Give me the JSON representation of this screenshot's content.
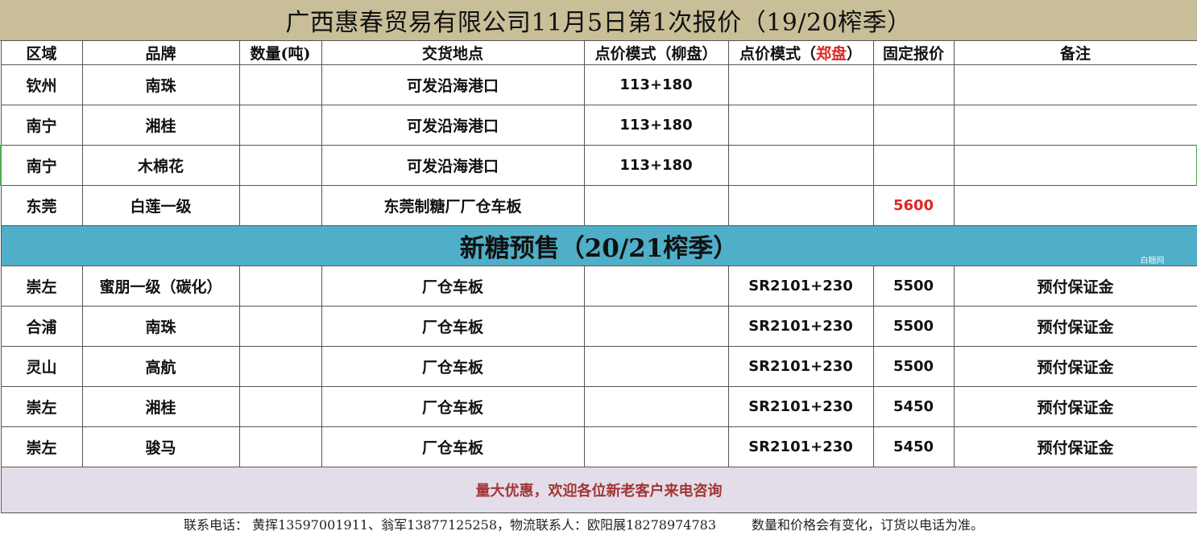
{
  "title": "广西惠春贸易有限公司11月5日第1次报价（19/20榨季）",
  "headers": {
    "region": "区域",
    "brand": "品牌",
    "quantity": "数量(吨)",
    "delivery": "交货地点",
    "pricing_liu_prefix": "点价模式（柳盘）",
    "pricing_zheng_prefix": "点价模式（",
    "pricing_zheng_red": "郑盘",
    "pricing_zheng_suffix": "）",
    "fixed_price": "固定报价",
    "remarks": "备注"
  },
  "current_rows": [
    {
      "region": "钦州",
      "brand": "南珠",
      "quantity": "",
      "delivery": "可发沿海港口",
      "liu": "113+180",
      "zheng": "",
      "fixed": "",
      "remarks": ""
    },
    {
      "region": "南宁",
      "brand": "湘桂",
      "quantity": "",
      "delivery": "可发沿海港口",
      "liu": "113+180",
      "zheng": "",
      "fixed": "",
      "remarks": ""
    },
    {
      "region": "南宁",
      "brand": "木棉花",
      "quantity": "",
      "delivery": "可发沿海港口",
      "liu": "113+180",
      "zheng": "",
      "fixed": "",
      "remarks": ""
    },
    {
      "region": "东莞",
      "brand": "白莲一级",
      "quantity": "",
      "delivery": "东莞制糖厂厂仓车板",
      "liu": "",
      "zheng": "",
      "fixed": "5600",
      "remarks": ""
    }
  ],
  "section_title": "新糖预售（20/21榨季）",
  "watermark": "白糖网",
  "presale_rows": [
    {
      "region": "崇左",
      "brand": "蜜朋一级（碳化）",
      "quantity": "",
      "delivery": "厂仓车板",
      "liu": "",
      "zheng": "SR2101+230",
      "fixed": "5500",
      "remarks": "预付保证金"
    },
    {
      "region": "合浦",
      "brand": "南珠",
      "quantity": "",
      "delivery": "厂仓车板",
      "liu": "",
      "zheng": "SR2101+230",
      "fixed": "5500",
      "remarks": "预付保证金"
    },
    {
      "region": "灵山",
      "brand": "高航",
      "quantity": "",
      "delivery": "厂仓车板",
      "liu": "",
      "zheng": "SR2101+230",
      "fixed": "5500",
      "remarks": "预付保证金"
    },
    {
      "region": "崇左",
      "brand": "湘桂",
      "quantity": "",
      "delivery": "厂仓车板",
      "liu": "",
      "zheng": "SR2101+230",
      "fixed": "5450",
      "remarks": "预付保证金"
    },
    {
      "region": "崇左",
      "brand": "骏马",
      "quantity": "",
      "delivery": "厂仓车板",
      "liu": "",
      "zheng": "SR2101+230",
      "fixed": "5450",
      "remarks": "预付保证金"
    }
  ],
  "promo": "量大优惠，欢迎各位新老客户来电咨询",
  "footer": {
    "contact": "联系电话：  黄挥13597001911、翁军13877125258，物流联系人：欧阳展18278974783",
    "note": "数量和价格会有变化，订货以电话为准。"
  },
  "colors": {
    "title_bg": "#c8bf99",
    "section_bg": "#4fafc8",
    "promo_bg": "#e3dde9",
    "promo_text": "#a33535",
    "accent_red": "#e0261f"
  }
}
